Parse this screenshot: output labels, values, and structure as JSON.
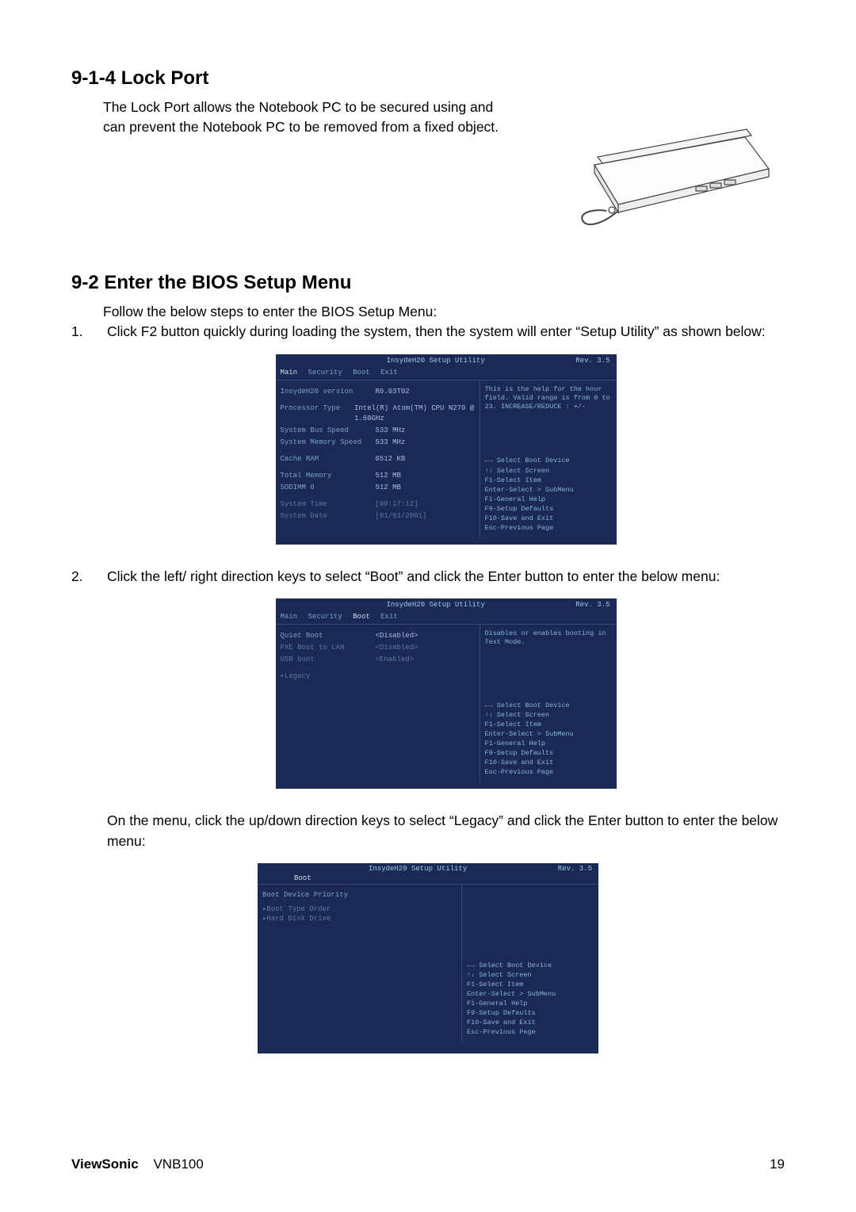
{
  "section1": {
    "heading": "9-1-4 Lock Port",
    "paragraph": "The Lock Port allows the Notebook PC to be secured using and can prevent the Notebook PC to be removed from a fixed object."
  },
  "section2": {
    "heading": "9-2 Enter the BIOS Setup Menu",
    "intro": "Follow the below steps to enter the BIOS Setup Menu:",
    "steps": [
      {
        "num": "1.",
        "text": "Click F2 button quickly during loading the system, then the system will enter “Setup Utility” as shown below:"
      },
      {
        "num": "2.",
        "text": "Click the left/ right direction keys to select “Boot” and click the Enter button to enter the below menu:"
      }
    ],
    "mid_paragraph": "On the menu, click the up/down direction keys to select “Legacy” and click the Enter button to enter the below menu:"
  },
  "bios_common": {
    "title": "InsydeH20 Setup Utility",
    "rev": "Rev. 3.5",
    "tabs": [
      "Main",
      "Security",
      "Boot",
      "Exit"
    ],
    "help_keys": [
      "←→   Select Boot Device",
      "↑↓   Select Screen",
      "F1-Select Item",
      "Enter-Select > SubMenu",
      "F1-General Help",
      "F9-Setup Defaults",
      "F10-Save and Exit",
      "Esc-Previous Page"
    ]
  },
  "bios1": {
    "help_top": "This is the help for the hour field. Valid range is from 0 to 23. INCREASE/REDUCE : +/-",
    "rows": [
      {
        "label": "InsydeH20 version",
        "value": "R0.03T02"
      },
      {
        "label": "Processor Type",
        "value": "Intel(R) Atom(TM) CPU N270 @ 1.60GHz"
      },
      {
        "label": "System Bus Speed",
        "value": "533 MHz"
      },
      {
        "label": "System Memory Speed",
        "value": "533 MHz"
      },
      {
        "label": "Cache RAM",
        "value": "0512 KB"
      },
      {
        "label": "Total Memory",
        "value": "512 MB"
      },
      {
        "label": "SODIMM 0",
        "value": "512 MB"
      },
      {
        "label": "System Time",
        "value": "[00:17:12]"
      },
      {
        "label": "System Date",
        "value": "[01/01/2001]"
      }
    ]
  },
  "bios2": {
    "help_top": "Disables or enables booting in Text Mode.",
    "rows": [
      {
        "label": "Quiet Boot",
        "value": "<Disabled>"
      },
      {
        "label": "PXE Boot to LAN",
        "value": "<Disabled>"
      },
      {
        "label": "USB boot",
        "value": "<Enabled>"
      },
      {
        "label": "▸Legacy",
        "value": ""
      }
    ]
  },
  "bios3": {
    "heading_row": "Boot Device Priority",
    "rows": [
      {
        "label": "▸Boot Type Order",
        "value": ""
      },
      {
        "label": "▸Hard Disk Drive",
        "value": ""
      }
    ]
  },
  "footer": {
    "brand": "ViewSonic",
    "model": "VNB100",
    "page": "19"
  }
}
